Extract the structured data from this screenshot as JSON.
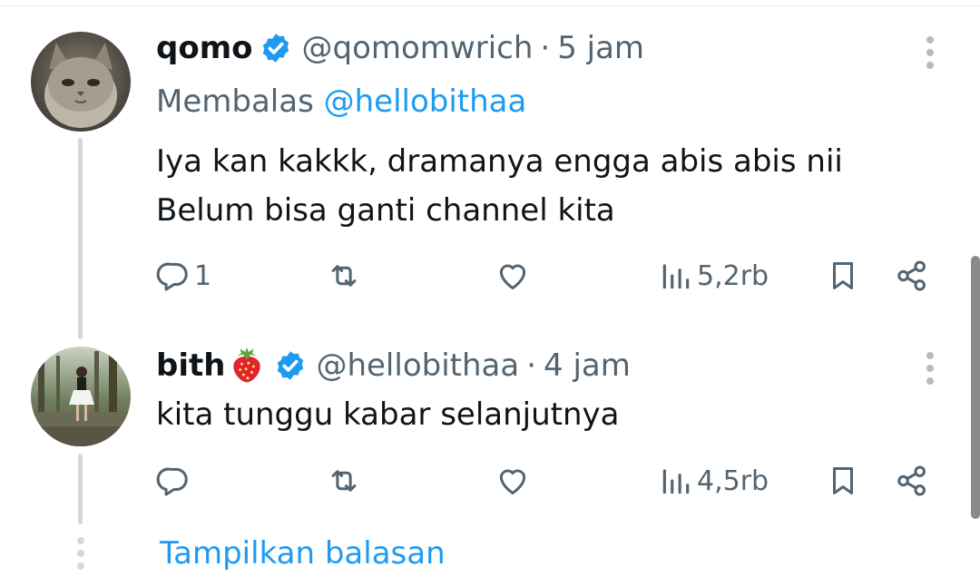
{
  "tweets": [
    {
      "name": "qomo",
      "handle": "@qomomwrich",
      "separator": "·",
      "time": "5 jam",
      "reply_prefix": "Membalas",
      "reply_to": "@hellobithaa",
      "lines": [
        "Iya kan kakkk, dramanya engga abis abis nii",
        "Belum bisa ganti channel kita"
      ],
      "stats": {
        "replies": "1",
        "retweets": "",
        "likes": "",
        "views": "5,2rb"
      }
    },
    {
      "name": "bith",
      "name_emoji": "strawberry-emoji",
      "handle": "@hellobithaa",
      "separator": "·",
      "time": "4 jam",
      "lines": [
        "kita tunggu kabar selanjutnya"
      ],
      "stats": {
        "replies": "",
        "retweets": "",
        "likes": "",
        "views": "4,5rb"
      }
    }
  ],
  "show_replies_label": "Tampilkan balasan",
  "icons": [
    "verified-badge-icon",
    "more-icon",
    "reply-icon",
    "retweet-icon",
    "like-icon",
    "views-icon",
    "bookmark-icon",
    "share-icon"
  ],
  "colors": {
    "accent": "#1d9bf0",
    "secondary_text": "#536471",
    "primary_text": "#0f1419",
    "thread_line": "#cfd9de"
  }
}
